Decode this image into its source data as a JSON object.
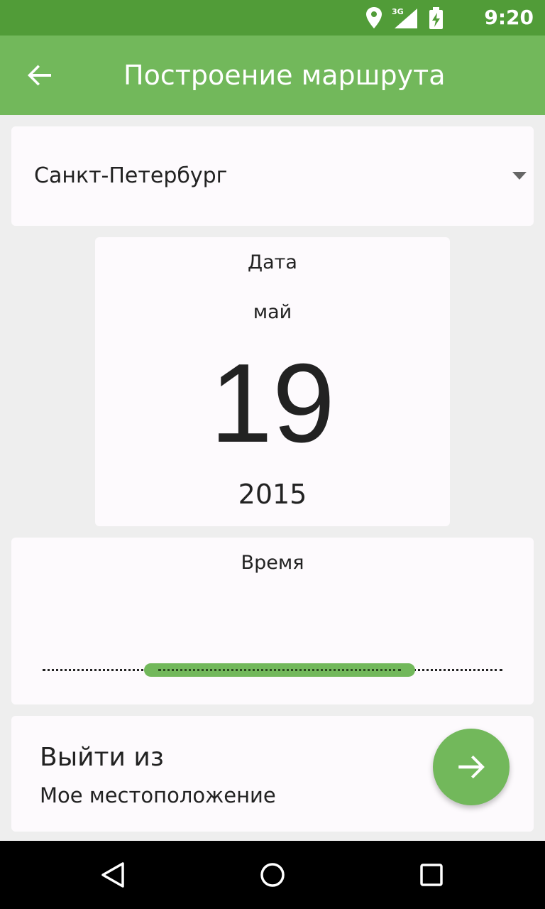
{
  "status_bar": {
    "time": "9:20",
    "network": "3G",
    "icons": [
      "location-icon",
      "signal-icon",
      "battery-icon"
    ]
  },
  "app_bar": {
    "title": "Построение маршрута",
    "back_icon": "arrow-back-icon",
    "color": "#72b85b"
  },
  "city": {
    "selected": "Санкт-Петербург"
  },
  "date": {
    "label": "Дата",
    "month": "май",
    "day": "19",
    "year": "2015"
  },
  "time": {
    "label": "Время",
    "range": {
      "start_fraction": 0.22,
      "end_fraction": 0.81
    }
  },
  "departure": {
    "title": "Выйти из",
    "location": "Мое местоположение",
    "action_icon": "arrow-forward-icon"
  },
  "nav": [
    "back-nav-icon",
    "home-nav-icon",
    "recents-nav-icon"
  ],
  "colors": {
    "status_bar": "#519c38",
    "accent": "#72b85b",
    "background": "#eeeeee",
    "card": "#fdfafd"
  }
}
